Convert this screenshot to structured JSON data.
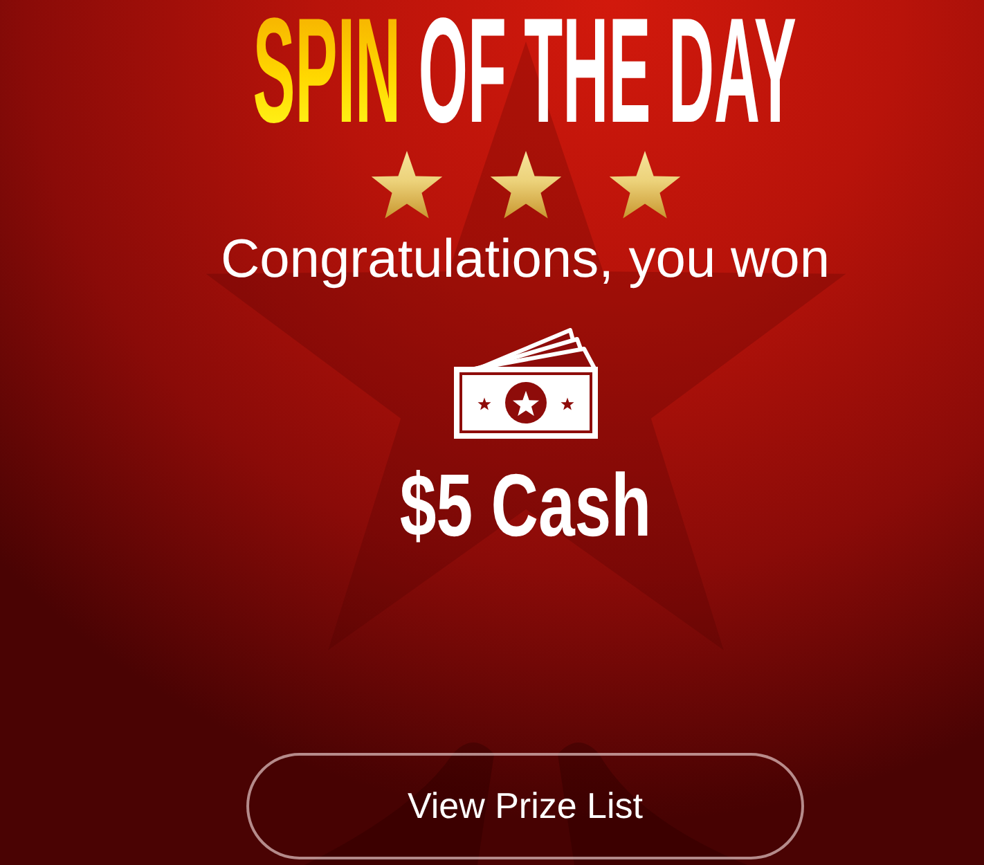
{
  "title": {
    "accent": "SPIN",
    "text": "OF THE DAY"
  },
  "rating": {
    "stars": 3
  },
  "message": "Congratulations, you won",
  "prize": "$5 Cash",
  "button": {
    "label": "View Prize List"
  }
}
